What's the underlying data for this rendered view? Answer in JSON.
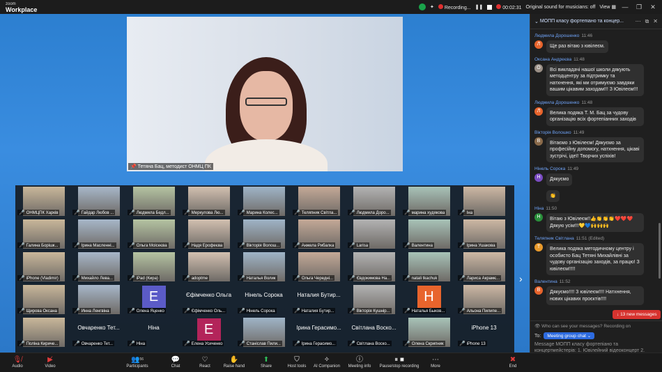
{
  "app": {
    "brand_top": "zoom",
    "brand_name": "Workplace"
  },
  "titlebar": {
    "recording": "Recording...",
    "timer": "00:02:31",
    "original_sound": "Original sound for musicians: off",
    "view": "View"
  },
  "speaker": {
    "name": "Тетяна Бац, методист ОНМЦ ПК"
  },
  "gallery": [
    {
      "name": "ОНМЦПК Харків",
      "muted": true
    },
    {
      "name": "Гайдар Любов ...",
      "muted": true
    },
    {
      "name": "Людмила Бедл...",
      "muted": true
    },
    {
      "name": "Меркулова Лю...",
      "muted": true
    },
    {
      "name": "Марина Колес...",
      "muted": true
    },
    {
      "name": "Теляпник Світла...",
      "muted": true
    },
    {
      "name": "Людмила Доро...",
      "muted": true
    },
    {
      "name": "марина худякова",
      "muted": true
    },
    {
      "name": "Іна",
      "muted": true
    },
    {
      "name": "Галина Борішк...",
      "muted": true
    },
    {
      "name": "Ірина Масленні...",
      "muted": true
    },
    {
      "name": "Ольга Моісеєва",
      "muted": true
    },
    {
      "name": "Надя Ерофеєва",
      "muted": true
    },
    {
      "name": "Вікторія Волош...",
      "muted": true
    },
    {
      "name": "Анжела Рибалка",
      "muted": true
    },
    {
      "name": "Larisa",
      "muted": true
    },
    {
      "name": "Валентина",
      "muted": true
    },
    {
      "name": "Ірина Ушакова",
      "muted": true
    },
    {
      "name": "iPhone (Vladimir)",
      "muted": true
    },
    {
      "name": "Михайло Лева...",
      "muted": true
    },
    {
      "name": "iPad (Кира)",
      "muted": true
    },
    {
      "name": "adoptme",
      "muted": true
    },
    {
      "name": "Наталья Волик",
      "muted": true
    },
    {
      "name": "Ольга Чередні...",
      "muted": true
    },
    {
      "name": "Євдокимова На...",
      "muted": true
    },
    {
      "name": "natali tkachuk",
      "muted": true
    },
    {
      "name": "Лариса Акрамє...",
      "muted": true
    },
    {
      "name": "Щирова Оксана",
      "muted": true
    },
    {
      "name": "Инна Ленгвіна",
      "muted": true
    },
    {
      "name": "Олена Яценко",
      "muted": true,
      "avatar": "E",
      "avatar_color": "#5b5bc7"
    },
    {
      "name": "Єфімченко Оль...",
      "muted": true,
      "display": "Єфімченко Ольга"
    },
    {
      "name": "Нінель Сорока",
      "muted": true,
      "display": "Нінель Сорока"
    },
    {
      "name": "Наталия Бутир...",
      "muted": true,
      "display": "Наталия Бутир..."
    },
    {
      "name": "Вікторія Кушнір...",
      "muted": true
    },
    {
      "name": "Наталья Быков...",
      "muted": true,
      "avatar": "H",
      "avatar_color": "#e8642c"
    },
    {
      "name": "Альона Пилипе...",
      "muted": true
    },
    {
      "name": "Поліна Кириче...",
      "muted": true
    },
    {
      "name": "Овчаренко Тет...",
      "muted": true,
      "display": "Овчаренко Тет..."
    },
    {
      "name": "Ніна",
      "muted": true,
      "display": "Ніна"
    },
    {
      "name": "Елена Усиченко",
      "muted": true,
      "avatar": "E",
      "avatar_color": "#b3245a"
    },
    {
      "name": "Станіслав Пили...",
      "muted": true
    },
    {
      "name": "Ірина Герасимо...",
      "muted": true,
      "display": "Ірина Герасимо..."
    },
    {
      "name": "Світлана Воско...",
      "muted": true,
      "display": "Світлана Воско..."
    },
    {
      "name": "Олена Скрипник",
      "muted": true
    },
    {
      "name": "iPhone 13",
      "muted": true,
      "display": "iPhone 13"
    }
  ],
  "chat": {
    "title": "МОПП класу фортепіано та концер...",
    "messages": [
      {
        "sender": "Людмила Дорошенко",
        "time": "11:46",
        "initial": "Л",
        "color": "#e8642c",
        "text": "Ще раз вітаю з ювілеєм."
      },
      {
        "sender": "Оксана Андреєва",
        "time": "11:48",
        "initial": "О",
        "color": "#9a8f86",
        "text": "Всі викладачі нашої школи дякують методцентру  за підтримку та натхнення, які ми отримуємо завдяки вашим цікавим заходам!!! З Ювілеєм!!!"
      },
      {
        "sender": "Людмила Дорошенко",
        "time": "11:48",
        "initial": "Л",
        "color": "#e8642c",
        "text": " Велика подяка Т. М. Бац за чудову організацію всіх фортепіанних заходів"
      },
      {
        "sender": "Вікторія Волошко",
        "time": "11:49",
        "initial": "В",
        "color": "#8a6a4a",
        "text": "Вітаємо з Ювілеєм!  Дякуємо за професійну допомогу, натхнення, цікаві зустрічі, ідеї! Творчих успіхів!"
      },
      {
        "sender": "Нінель Сорока",
        "time": "11:49",
        "initial": "Н",
        "color": "#7b4cc2",
        "text": "Дякуємо"
      },
      {
        "sender": "Нінель Сорока",
        "time": "",
        "initial": "",
        "color": "",
        "text": "👏"
      },
      {
        "sender": "Ніна",
        "time": "11:50",
        "initial": "Н",
        "color": "#2a8f3b",
        "text": "Вітаю з Ювілеєм!!👍👏👏👏❤️❤️❤️Дякую усім!!!💛💙🙌🙌🙌"
      },
      {
        "sender": "Теляпник Світлана",
        "time": "11:51 (Edited)",
        "initial": "Т",
        "color": "#e89a2c",
        "text": "Велика подяка методичному центру і особисто Бац Тетяні Михайлівні за чудову організацію заходів, за працю! З ювілеєм!!!!!"
      },
      {
        "sender": "Валентина",
        "time": "11:52",
        "initial": "В",
        "color": "#e8642c",
        "text": "Дякуємо!!!! З ювілеєм!!!! Натхнення, нових цікавих проєктів!!!!"
      }
    ],
    "new_messages": "13 new messages",
    "who_can_see": "Who can see your messages? Recording on",
    "to_label": "To:",
    "to_value": "Meeting group chat",
    "compose_placeholder": "Message МОПП класу фортепіано та концертмейстерів: 1. Ювілейний відеоконцерт 2."
  },
  "toolbar": {
    "audio": "Audio",
    "video": "Video",
    "participants": "Participants",
    "participants_count": "56",
    "chat": "Chat",
    "react": "React",
    "raise_hand": "Raise hand",
    "share": "Share",
    "host_tools": "Host tools",
    "ai_companion": "AI Companion",
    "meeting_info": "Meeting info",
    "pause_recording": "Pause/stop recording",
    "more": "More",
    "end": "End"
  }
}
